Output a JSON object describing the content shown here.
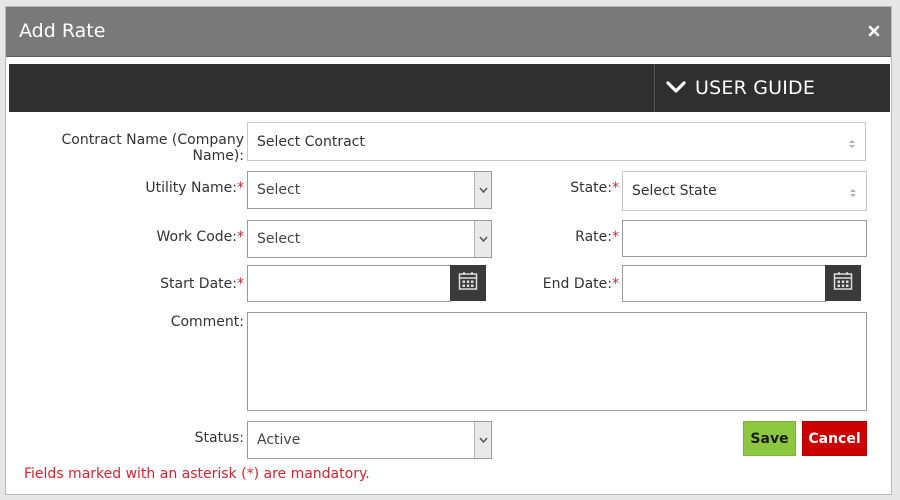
{
  "dialog": {
    "title": "Add Rate",
    "close_icon": "close-x-icon"
  },
  "guide_bar": {
    "label": "USER GUIDE",
    "icon": "chevron-down-icon"
  },
  "form": {
    "required_marker": "*",
    "contract": {
      "label": "Contract Name (Company Name):",
      "value": "Select Contract"
    },
    "utility": {
      "label": "Utility Name:",
      "value": "Select"
    },
    "state": {
      "label": "State:",
      "value": "Select State"
    },
    "work_code": {
      "label": "Work Code:",
      "value": "Select"
    },
    "rate": {
      "label": "Rate:",
      "value": ""
    },
    "start_date": {
      "label": "Start Date:",
      "value": ""
    },
    "end_date": {
      "label": "End Date:",
      "value": ""
    },
    "comment": {
      "label": "Comment:",
      "value": ""
    },
    "status": {
      "label": "Status:",
      "value": "Active"
    }
  },
  "actions": {
    "save_label": "Save",
    "cancel_label": "Cancel"
  },
  "mandatory_note": "Fields marked with an asterisk (*) are mandatory.",
  "colors": {
    "title_bar": "#797979",
    "guide_bar": "#2f2f2f",
    "save": "#8dc63f",
    "cancel": "#cc0000",
    "required": "#d9232d"
  }
}
